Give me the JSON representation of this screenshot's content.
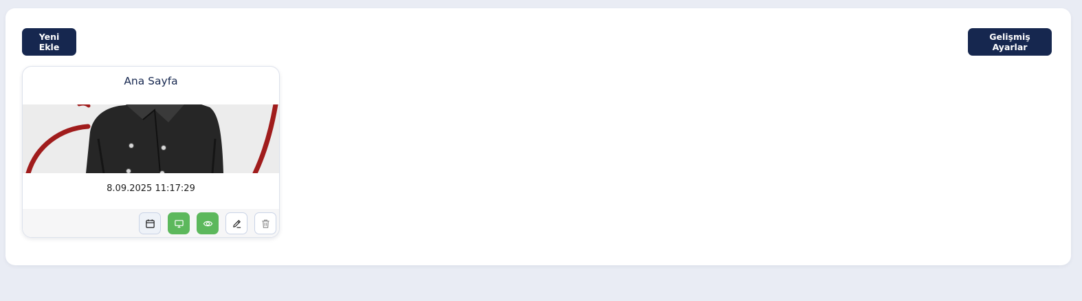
{
  "toolbar": {
    "new_label": "Yeni Ekle",
    "advanced_label": "Gelişmiş Ayarlar"
  },
  "cards": [
    {
      "title": "Ana Sayfa",
      "date": "8.09.2025 11:17:29",
      "actions": [
        "calendar-icon",
        "monitor-icon",
        "eye-icon",
        "edit-icon",
        "trash-icon"
      ]
    }
  ],
  "colors": {
    "primary": "#16274f",
    "success": "#5cb85c",
    "background": "#e9ecf4",
    "accent_red": "#a01c1c"
  }
}
